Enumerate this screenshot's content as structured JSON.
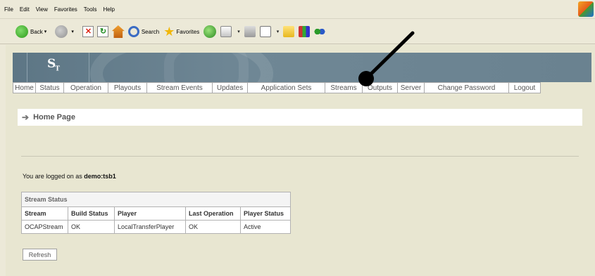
{
  "menubar": {
    "items": [
      "File",
      "Edit",
      "View",
      "Favorites",
      "Tools",
      "Help"
    ]
  },
  "toolbar": {
    "back_label": "Back",
    "search_label": "Search",
    "favorites_label": "Favorites",
    "icons": [
      "back-icon",
      "forward-icon",
      "stop-icon",
      "refresh-icon",
      "home-icon",
      "search-icon",
      "favorites-star-icon",
      "media-icon",
      "mail-icon",
      "print-icon",
      "edit-icon",
      "folder-icon",
      "research-icon",
      "messenger-icon"
    ]
  },
  "banner": {
    "logo_text": "S",
    "logo_sub": "T"
  },
  "nav": {
    "tabs": [
      "Home",
      "Status",
      "Operation",
      "Playouts",
      "Stream Events",
      "Updates",
      "Application Sets",
      "Streams",
      "Outputs",
      "Server",
      "Change Password",
      "Logout"
    ]
  },
  "page": {
    "title": "Home Page",
    "logged_prefix": "You are logged on as ",
    "logged_user": "demo:tsb1"
  },
  "stream_status": {
    "caption": "Stream Status",
    "columns": [
      "Stream",
      "Build Status",
      "Player",
      "Last Operation",
      "Player Status"
    ],
    "rows": [
      [
        "OCAPStream",
        "OK",
        "LocalTransferPlayer",
        "OK",
        "Active"
      ]
    ]
  },
  "refresh_label": "Refresh",
  "colors": {
    "banner": "#6a8290",
    "page_bg": "#e8e6d1",
    "chrome_bg": "#ece9d8"
  }
}
